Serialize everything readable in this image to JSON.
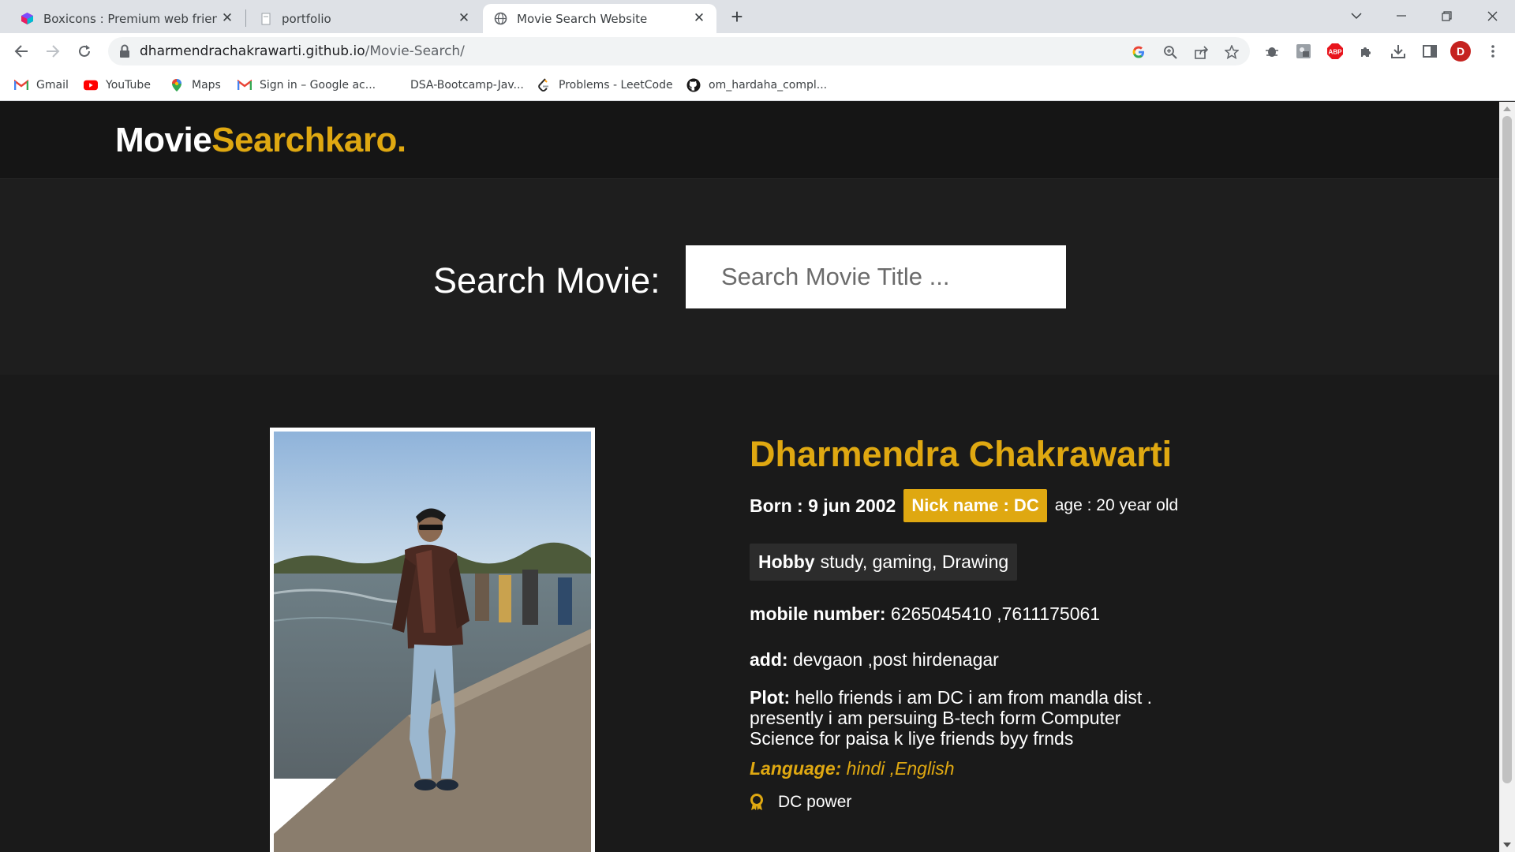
{
  "browser": {
    "tabs": [
      {
        "title": "Boxicons : Premium web friendly",
        "active": false
      },
      {
        "title": "portfolio",
        "active": false
      },
      {
        "title": "Movie Search Website",
        "active": true
      }
    ],
    "url_domain": "dharmendrachakrawarti.github.io",
    "url_path": "/Movie-Search/",
    "profile_initial": "D",
    "bookmarks": [
      {
        "label": "Gmail",
        "icon": "gmail-icon"
      },
      {
        "label": "YouTube",
        "icon": "youtube-icon"
      },
      {
        "label": "Maps",
        "icon": "maps-icon"
      },
      {
        "label": "Sign in – Google ac...",
        "icon": "gmail-icon"
      },
      {
        "label": "DSA-Bootcamp-Jav...",
        "icon": "none"
      },
      {
        "label": "Problems - LeetCode",
        "icon": "leetcode-icon"
      },
      {
        "label": "om_hardaha_compl...",
        "icon": "github-icon"
      }
    ]
  },
  "site": {
    "logo_main": "Movie",
    "logo_accent": "Searchkaro.",
    "accent_color": "#dfa811",
    "search": {
      "label": "Search Movie:",
      "placeholder": "Search Movie Title ...",
      "value": ""
    },
    "profile": {
      "name": "Dharmendra Chakrawarti",
      "born": "Born : 9 jun 2002",
      "nick": "Nick name : DC",
      "age": "age : 20 year old",
      "hobby_label": "Hobby",
      "hobby_value": "study, gaming, Drawing",
      "mobile_label": "mobile number:",
      "mobile_value": "6265045410 ,7611175061",
      "address_label": "add:",
      "address_value": "devgaon ,post hirdenagar",
      "plot_label": "Plot:",
      "plot_value": "hello friends i am DC i am from mandla dist . presently i am persuing B-tech form Computer Science for paisa k liye friends byy frnds",
      "language_label": "Language:",
      "language_value": "hindi ,English",
      "award": "DC power"
    }
  }
}
